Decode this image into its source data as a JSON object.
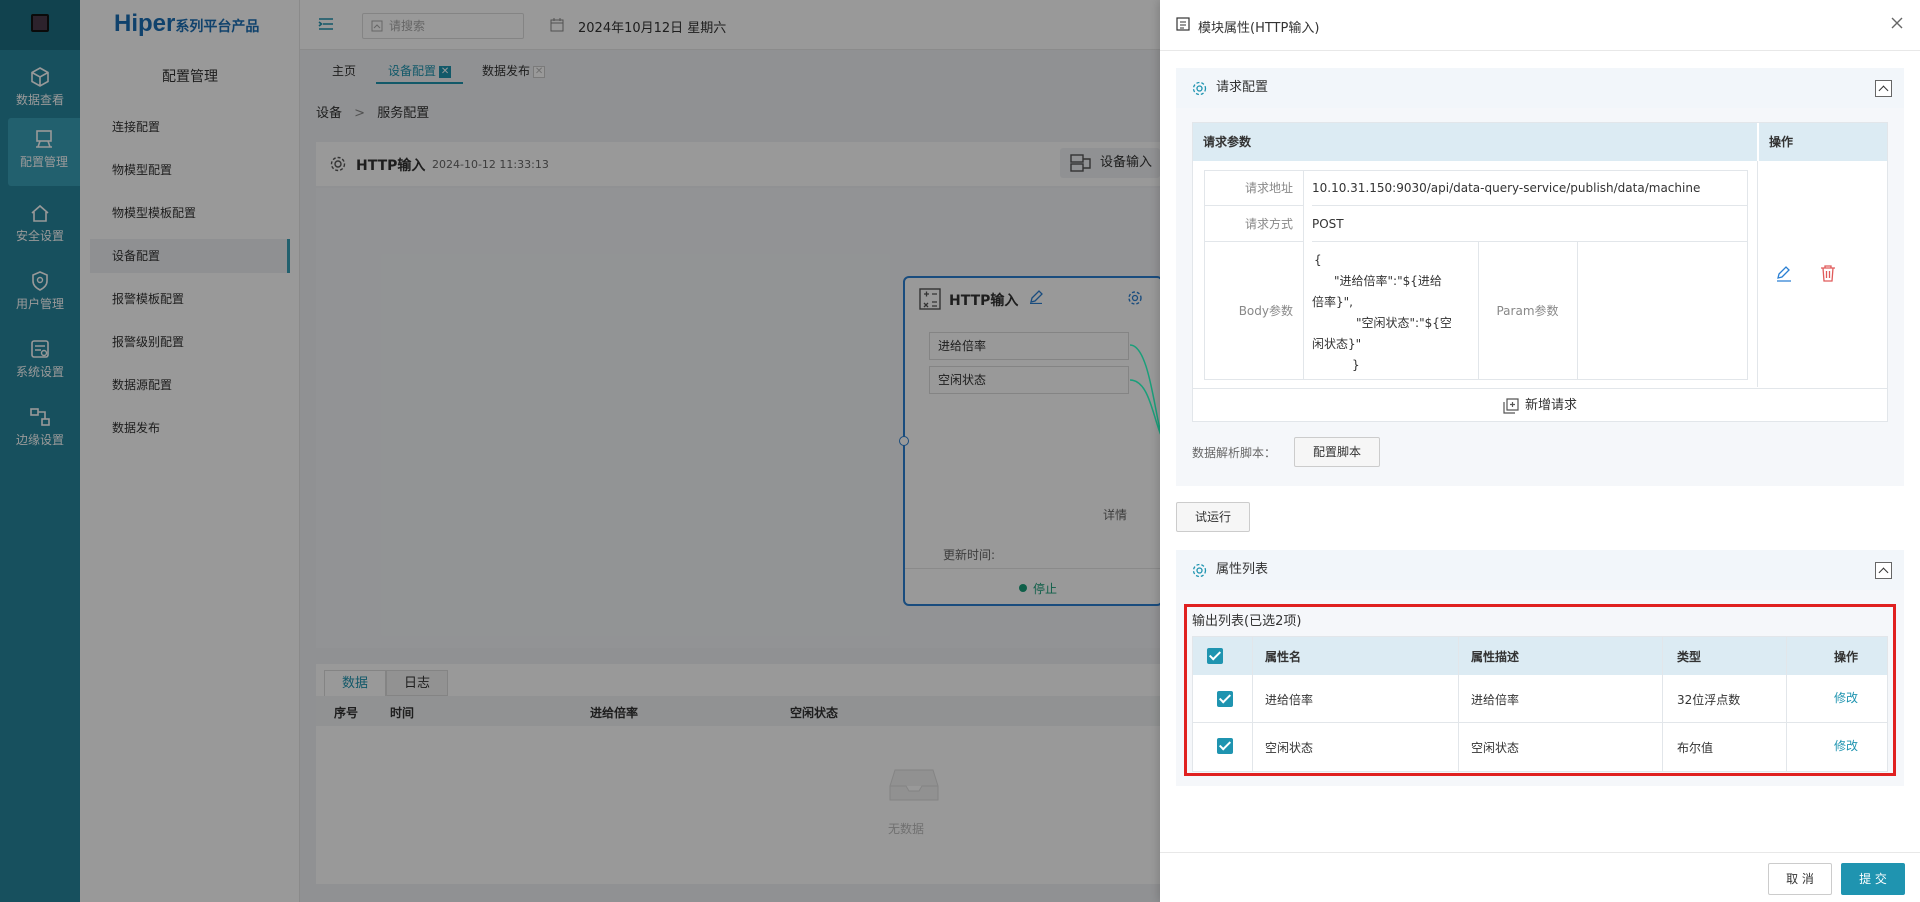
{
  "rail": {
    "items": [
      {
        "label": "数据查看",
        "icon": "cube-icon"
      },
      {
        "label": "配置管理",
        "icon": "config-icon"
      },
      {
        "label": "安全设置",
        "icon": "shield-home-icon"
      },
      {
        "label": "用户管理",
        "icon": "user-shield-icon"
      },
      {
        "label": "系统设置",
        "icon": "system-icon"
      },
      {
        "label": "边缘设置",
        "icon": "edge-icon"
      }
    ]
  },
  "brand": {
    "name": "Hiper",
    "suffix": "系列平台产品"
  },
  "menu": {
    "title": "配置管理",
    "items": [
      "连接配置",
      "物模型配置",
      "物模型模板配置",
      "设备配置",
      "报警模板配置",
      "报警级别配置",
      "数据源配置",
      "数据发布"
    ]
  },
  "topbar": {
    "search_placeholder": "请搜索",
    "date": "2024年10月12日 星期六"
  },
  "tabs": [
    {
      "label": "主页"
    },
    {
      "label": "设备配置"
    },
    {
      "label": "数据发布"
    }
  ],
  "breadcrumb": {
    "root": "设备",
    "sep": ">",
    "current": "服务配置"
  },
  "panel": {
    "title": "HTTP输入",
    "time": "2024-10-12 11:33:13",
    "device_btn": "设备输入"
  },
  "node": {
    "title": "HTTP输入",
    "ports": [
      "进给倍率",
      "空闲状态"
    ],
    "detail": "详情",
    "update_label": "更新时间:",
    "status": "停止"
  },
  "bottom": {
    "tabs": [
      "数据",
      "日志"
    ],
    "columns": [
      "序号",
      "时间",
      "进给倍率",
      "空闲状态"
    ],
    "empty": "无数据"
  },
  "drawer": {
    "title": "模块属性(HTTP输入)",
    "request_section": "请求配置",
    "table_header": {
      "params": "请求参数",
      "ops": "操作"
    },
    "url_label": "请求地址",
    "url": "10.10.31.150:9030/api/data-query-service/publish/data/machine",
    "method_label": "请求方式",
    "method": "POST",
    "body_label": "Body参数",
    "body_lines": [
      "{",
      "\"进给倍率\":\"${进给",
      "倍率}\",",
      "\"空闲状态\":\"${空",
      "闲状态}\"",
      "}"
    ],
    "param_label": "Param参数",
    "add_request": "新增请求",
    "script_label": "数据解析脚本：",
    "script_btn": "配置脚本",
    "trial_btn": "试运行",
    "attr_section": "属性列表",
    "output_label": "输出列表(已选2项)",
    "attr_columns": [
      "属性名",
      "属性描述",
      "类型",
      "操作"
    ],
    "attr_rows": [
      {
        "name": "进给倍率",
        "desc": "进给倍率",
        "type": "32位浮点数",
        "op": "修改"
      },
      {
        "name": "空闲状态",
        "desc": "空闲状态",
        "type": "布尔值",
        "op": "修改"
      }
    ],
    "cancel": "取 消",
    "submit": "提 交"
  },
  "colors": {
    "accent": "#1f94b0",
    "rail": "#27869d",
    "highlight": "#e02020",
    "submit": "#1f94b0"
  }
}
